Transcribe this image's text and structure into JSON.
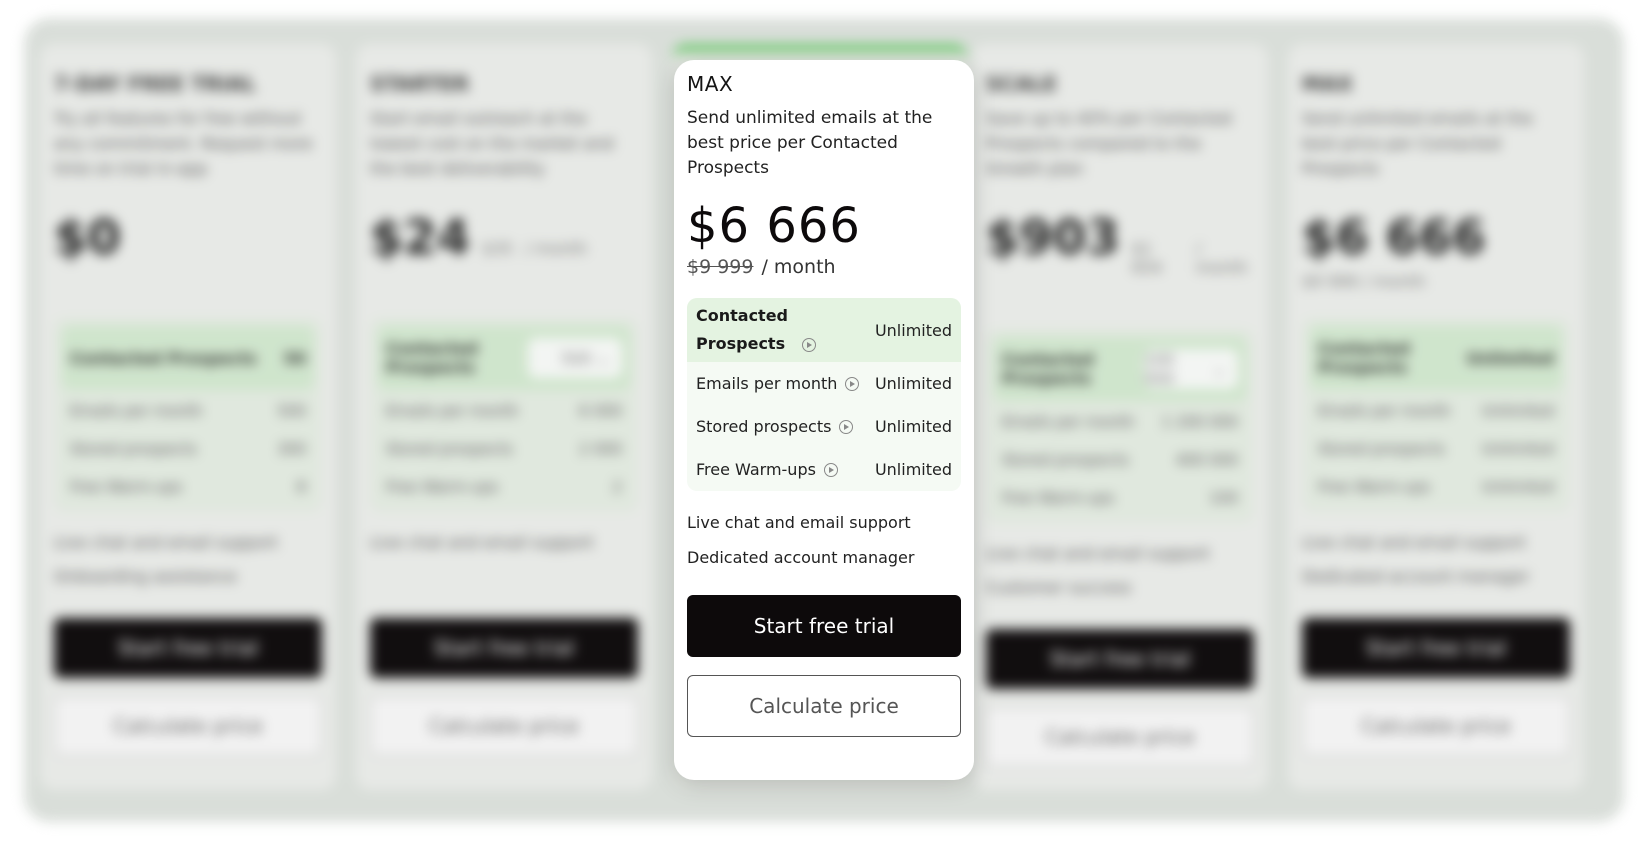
{
  "background_plans": [
    {
      "title": "7-DAY FREE TRIAL",
      "description": "Try all features for free without any commitment. Request more time on trial in-app",
      "price": "$0",
      "old_price": "",
      "period": "",
      "contacted": "50",
      "emails": "500",
      "stored": "300",
      "warmups": "8",
      "extra1": "Live chat and email support",
      "extra2": "Onboarding assistance",
      "cta": "Start free trial",
      "secondary": "Calculate price"
    },
    {
      "title": "STARTER",
      "description": "Start email outreach at the lowest cost on the market and the best deliverability",
      "price": "$24",
      "old_price": "$35",
      "period": "/ month",
      "contacted": "500",
      "emails": "6 000",
      "stored": "2 000",
      "warmups": "2",
      "extra1": "Live chat and email support",
      "extra2": "",
      "cta": "Start free trial",
      "secondary": "Calculate price"
    },
    {
      "title": "SCALE",
      "description": "Save up to 40% per Contacted Prospects compared to the Growth plan",
      "price": "$903",
      "old_price": "$1 654",
      "period": "/ month",
      "contacted": "100 000",
      "emails": "1 200 000",
      "stored": "400 000",
      "warmups": "100",
      "extra1": "Live chat and email support",
      "extra2": "Customer success",
      "cta": "Start free trial",
      "secondary": "Calculate price"
    },
    {
      "title": "MAX",
      "description": "Send unlimited emails at the best price per Contacted Prospects",
      "price": "$6 666",
      "old_price": "$9 999",
      "period": "/ month",
      "contacted": "Unlimited",
      "emails": "Unlimited",
      "stored": "Unlimited",
      "warmups": "Unlimited",
      "extra1": "Live chat and email support",
      "extra2": "Dedicated account manager",
      "cta": "Start free trial",
      "secondary": "Calculate price"
    }
  ],
  "focused_plan": {
    "title": "MAX",
    "description": "Send unlimited emails at the best price per Contacted Prospects",
    "price": "$6 666",
    "old_price": "$9 999",
    "period": "/ month",
    "features": {
      "contacted_label": "Contacted Prospects",
      "contacted_value": "Unlimited",
      "emails_label": "Emails per month",
      "emails_value": "Unlimited",
      "stored_label": "Stored prospects",
      "stored_value": "Unlimited",
      "warmups_label": "Free Warm-ups",
      "warmups_value": "Unlimited"
    },
    "extra1": "Live chat and email support",
    "extra2": "Dedicated account manager",
    "cta": "Start free trial",
    "secondary": "Calculate price"
  },
  "colors": {
    "accent_green": "#69c76a",
    "highlight_green": "#e4f3e1",
    "button_dark": "#0d0a0b"
  },
  "icons": [
    "play-circle-icon",
    "chevron-down-icon"
  ]
}
